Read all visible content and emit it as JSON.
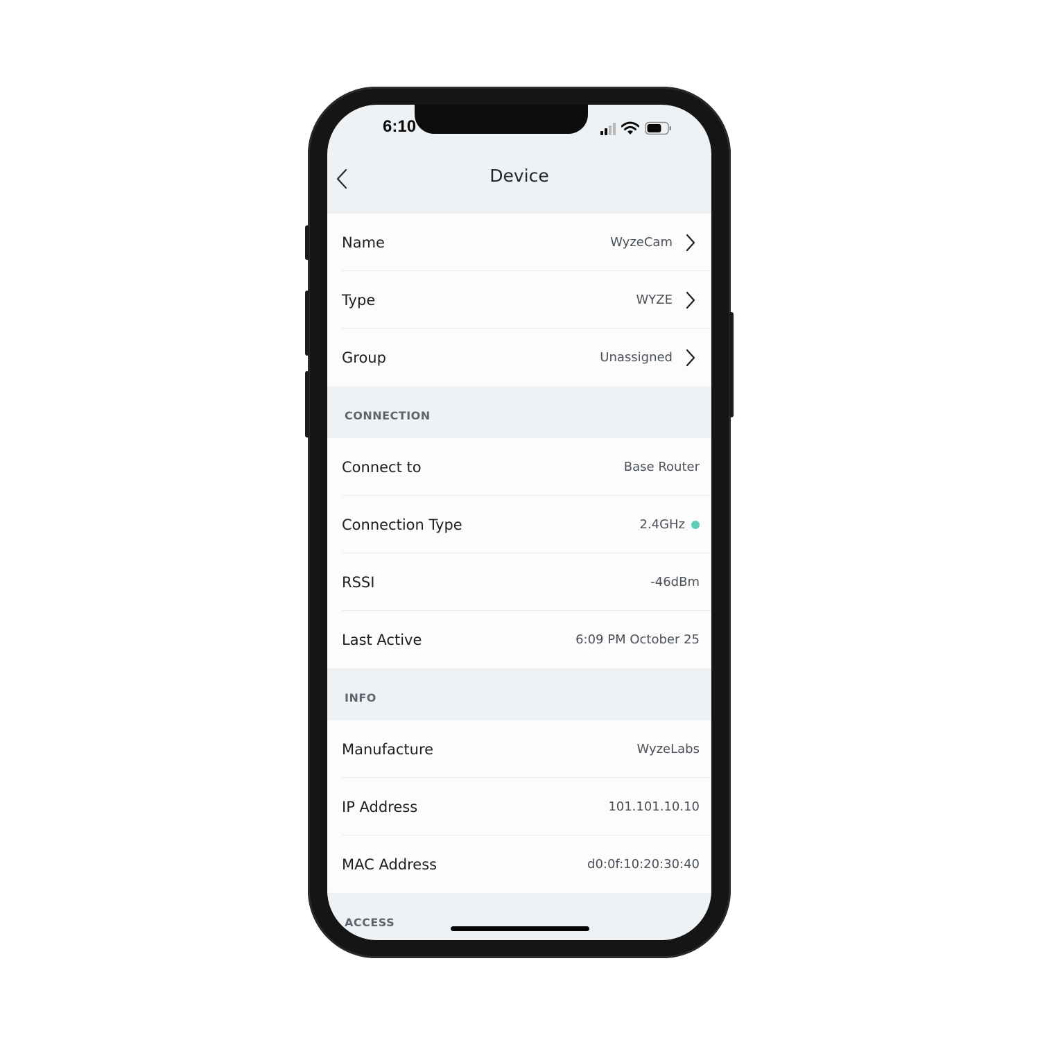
{
  "status_bar": {
    "time": "6:10",
    "icons": [
      "cellular-signal-icon",
      "wifi-icon",
      "battery-icon"
    ],
    "signal_bars_active": 2,
    "signal_bars_total": 4
  },
  "nav": {
    "title": "Device",
    "back_icon": "chevron-left-icon"
  },
  "general": {
    "rows": [
      {
        "label": "Name",
        "value": "WyzeCam",
        "chevron": true
      },
      {
        "label": "Type",
        "value": "WYZE",
        "chevron": true
      },
      {
        "label": "Group",
        "value": "Unassigned",
        "chevron": true
      }
    ]
  },
  "connection": {
    "header": "CONNECTION",
    "rows": [
      {
        "label": "Connect to",
        "value": "Base Router"
      },
      {
        "label": "Connection Type",
        "value": "2.4GHz",
        "status_dot_color": "#5ccdb8"
      },
      {
        "label": "RSSI",
        "value": "-46dBm"
      },
      {
        "label": "Last Active",
        "value": "6:09 PM October 25"
      }
    ]
  },
  "info": {
    "header": "INFO",
    "rows": [
      {
        "label": "Manufacture",
        "value": "WyzeLabs"
      },
      {
        "label": "IP Address",
        "value": "101.101.10.10"
      },
      {
        "label": "MAC Address",
        "value": "d0:0f:10:20:30:40"
      }
    ]
  },
  "access": {
    "header": "ACCESS"
  },
  "colors": {
    "background": "#eef2f5",
    "row_background": "#fcfcfc",
    "label_text": "#1c1f22",
    "value_text": "#4a5057",
    "section_header_text": "#5d656e",
    "status_dot": "#5ccdb8"
  }
}
